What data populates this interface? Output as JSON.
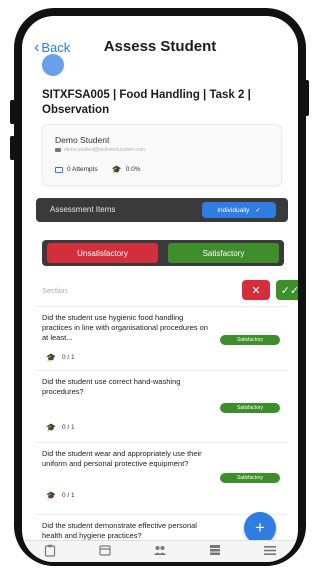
{
  "nav": {
    "back_label": "Back",
    "title": "Assess Student"
  },
  "course": {
    "title": "SITXFSA005 | Food Handling | Task 2 | Observation"
  },
  "student": {
    "name": "Demo Student",
    "email": "demo.student@activeeducation.com",
    "attempts": "0 Attempts",
    "score": "0.0%"
  },
  "assessment": {
    "label": "Assessment Items",
    "mode_label": "Individually",
    "mode_check": "✓"
  },
  "toggle": {
    "unsatisfactory": "Unsatisfactory",
    "satisfactory": "Satisfactory"
  },
  "section": {
    "label": "Section:",
    "x_glyph": "✕",
    "check_glyph": "✓✓"
  },
  "items": [
    {
      "question": "Did the student  use hygienic food handling practices in line with organisational procedures on at least...",
      "status": "Satisfactory",
      "score": "0 / 1"
    },
    {
      "question": "Did the student use correct hand-washing procedures?",
      "status": "Satisfactory",
      "score": "0 / 1"
    },
    {
      "question": "Did the student wear and appropriately use their uniform and personal protective equipment?",
      "status": "Satisfactory",
      "score": "0 / 1"
    },
    {
      "question": "Did the student demonstrate effective personal health and hygiene practices?",
      "status": "",
      "score": ""
    }
  ],
  "fab": {
    "glyph": "+"
  },
  "colors": {
    "accent": "#2f7de1",
    "unsatisfactory": "#d32f3a",
    "satisfactory": "#3e8e2c",
    "dark_bar": "#3a3a3c"
  },
  "icons": {
    "back": "chevron-left-icon",
    "email": "mail-icon",
    "attempts": "laptop-icon",
    "score": "graduation-cap-icon",
    "tabs": [
      "clipboard-icon",
      "calendar-icon",
      "people-icon",
      "grid-icon",
      "menu-icon"
    ]
  }
}
